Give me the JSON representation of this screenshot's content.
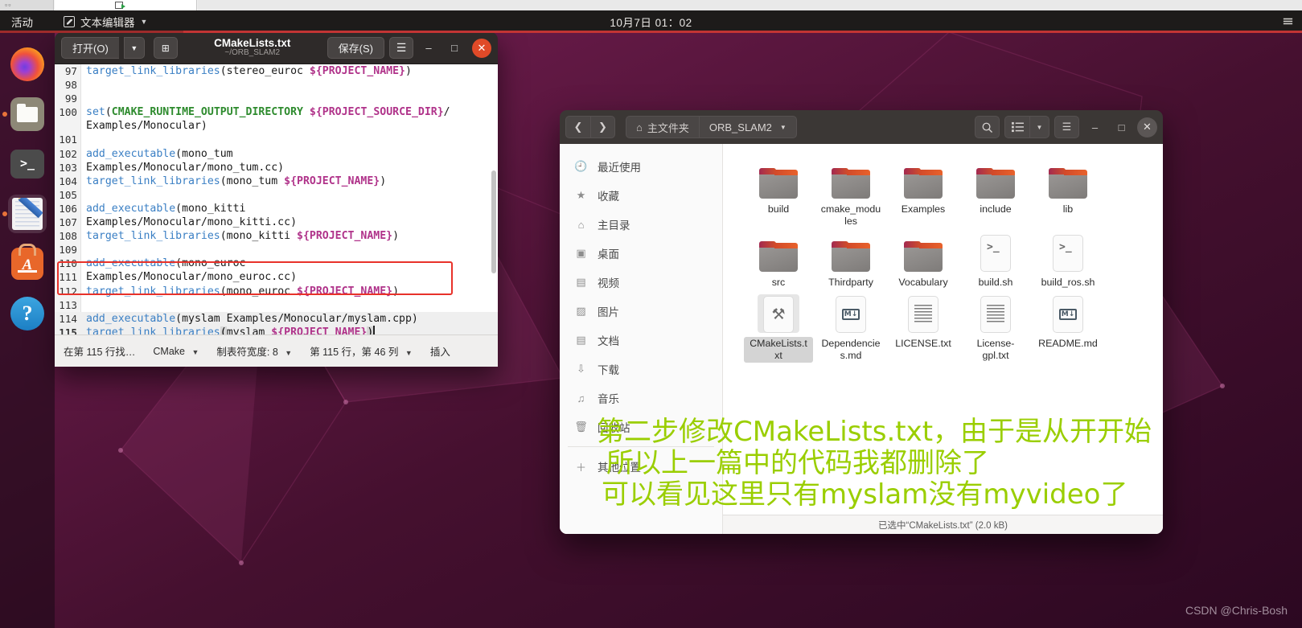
{
  "topbar": {
    "activities": "活动",
    "app_name": "文本编辑器",
    "app_icon": "text-editor-icon",
    "caret": "▼",
    "clock": "10月7日 01：02"
  },
  "dock": {
    "items": [
      {
        "name": "firefox",
        "label": "Firefox",
        "running": false
      },
      {
        "name": "files",
        "label": "文件",
        "running": true
      },
      {
        "name": "terminal",
        "label": "终端",
        "running": false
      },
      {
        "name": "text-editor",
        "label": "文本编辑器",
        "running": true
      },
      {
        "name": "ubuntu-software",
        "label": "Ubuntu 软件",
        "running": false
      },
      {
        "name": "help",
        "label": "帮助",
        "running": false
      }
    ]
  },
  "gedit": {
    "open_label": "打开(O)",
    "open_dropdown": "▼",
    "new_tab_icon": "new-tab-icon",
    "title": "CMakeLists.txt",
    "subtitle": "~/ORB_SLAM2",
    "save_label": "保存(S)",
    "menu_icon": "☰",
    "minimize": "–",
    "maximize": "□",
    "close": "✕",
    "lines": [
      {
        "n": "97",
        "parts": [
          {
            "t": "target_link_libraries",
            "c": "fn"
          },
          {
            "t": "(stereo_euroc ",
            "c": "pl"
          },
          {
            "t": "${PROJECT_NAME}",
            "c": "ref"
          },
          {
            "t": ")",
            "c": "pl"
          }
        ]
      },
      {
        "n": "98",
        "parts": []
      },
      {
        "n": "99",
        "parts": []
      },
      {
        "n": "100",
        "parts": [
          {
            "t": "set",
            "c": "fn"
          },
          {
            "t": "(",
            "c": "pl"
          },
          {
            "t": "CMAKE_RUNTIME_OUTPUT_DIRECTORY",
            "c": "var"
          },
          {
            "t": " ",
            "c": "pl"
          },
          {
            "t": "${PROJECT_SOURCE_DIR}",
            "c": "ref"
          },
          {
            "t": "/",
            "c": "pl"
          }
        ]
      },
      {
        "n": "",
        "parts": [
          {
            "t": "Examples/Monocular)",
            "c": "pl"
          }
        ]
      },
      {
        "n": "101",
        "parts": []
      },
      {
        "n": "102",
        "parts": [
          {
            "t": "add_executable",
            "c": "fn"
          },
          {
            "t": "(mono_tum",
            "c": "pl"
          }
        ]
      },
      {
        "n": "103",
        "parts": [
          {
            "t": "Examples/Monocular/mono_tum.cc)",
            "c": "pl"
          }
        ]
      },
      {
        "n": "104",
        "parts": [
          {
            "t": "target_link_libraries",
            "c": "fn"
          },
          {
            "t": "(mono_tum ",
            "c": "pl"
          },
          {
            "t": "${PROJECT_NAME}",
            "c": "ref"
          },
          {
            "t": ")",
            "c": "pl"
          }
        ]
      },
      {
        "n": "105",
        "parts": []
      },
      {
        "n": "106",
        "parts": [
          {
            "t": "add_executable",
            "c": "fn"
          },
          {
            "t": "(mono_kitti",
            "c": "pl"
          }
        ]
      },
      {
        "n": "107",
        "parts": [
          {
            "t": "Examples/Monocular/mono_kitti.cc)",
            "c": "pl"
          }
        ]
      },
      {
        "n": "108",
        "parts": [
          {
            "t": "target_link_libraries",
            "c": "fn"
          },
          {
            "t": "(mono_kitti ",
            "c": "pl"
          },
          {
            "t": "${PROJECT_NAME}",
            "c": "ref"
          },
          {
            "t": ")",
            "c": "pl"
          }
        ]
      },
      {
        "n": "109",
        "parts": []
      },
      {
        "n": "110",
        "parts": [
          {
            "t": "add_executable",
            "c": "fn"
          },
          {
            "t": "(mono_euroc",
            "c": "pl"
          }
        ]
      },
      {
        "n": "111",
        "parts": [
          {
            "t": "Examples/Monocular/mono_euroc.cc)",
            "c": "pl"
          }
        ]
      },
      {
        "n": "112",
        "parts": [
          {
            "t": "target_link_libraries",
            "c": "fn"
          },
          {
            "t": "(mono_euroc ",
            "c": "pl"
          },
          {
            "t": "${PROJECT_NAME}",
            "c": "ref"
          },
          {
            "t": ")",
            "c": "pl"
          }
        ]
      },
      {
        "n": "113",
        "parts": []
      },
      {
        "n": "114",
        "parts": [
          {
            "t": "add_executable",
            "c": "fn"
          },
          {
            "t": "(myslam Examples/Monocular/myslam.cpp)",
            "c": "pl"
          }
        ]
      },
      {
        "n": "115",
        "parts": [
          {
            "t": "target_link_libraries",
            "c": "fn"
          },
          {
            "t": "(",
            "c": "paren-hl"
          },
          {
            "t": "myslam ",
            "c": "pl"
          },
          {
            "t": "${PROJECT_NAME}",
            "c": "ref"
          },
          {
            "t": ")",
            "c": "paren-hl"
          }
        ]
      }
    ],
    "status": {
      "find": "在第 115 行找…",
      "language": "CMake",
      "language_caret": "▼",
      "tab_width": "制表符宽度: 8",
      "tab_caret": "▼",
      "position": "第 115 行，第 46 列",
      "position_caret": "▼",
      "mode": "插入"
    }
  },
  "nautilus": {
    "back_icon": "❮",
    "forward_icon": "❯",
    "home_icon": "⌂",
    "crumb_home": "主文件夹",
    "crumb_current": "ORB_SLAM2",
    "crumb_caret": "▼",
    "search_icon": "search-icon",
    "list_view_icon": "list-view-icon",
    "view_caret": "▼",
    "menu_icon": "☰",
    "minimize": "–",
    "maximize": "□",
    "close": "✕",
    "sidebar": [
      {
        "label": "最近使用",
        "icon": "clock-icon"
      },
      {
        "label": "收藏",
        "icon": "star-icon"
      },
      {
        "label": "主目录",
        "icon": "home-icon"
      },
      {
        "label": "桌面",
        "icon": "desktop-icon"
      },
      {
        "label": "视频",
        "icon": "video-icon"
      },
      {
        "label": "图片",
        "icon": "picture-icon"
      },
      {
        "label": "文档",
        "icon": "document-icon"
      },
      {
        "label": "下载",
        "icon": "download-icon"
      },
      {
        "label": "音乐",
        "icon": "music-icon"
      },
      {
        "label": "回收站",
        "icon": "trash-icon"
      }
    ],
    "sidebar_bottom": [
      {
        "label": "其他位置",
        "icon": "plus-icon"
      }
    ],
    "files": [
      {
        "name": "build",
        "type": "folder",
        "selected": false
      },
      {
        "name": "cmake_modules",
        "type": "folder",
        "selected": false
      },
      {
        "name": "Examples",
        "type": "folder",
        "selected": false
      },
      {
        "name": "include",
        "type": "folder",
        "selected": false
      },
      {
        "name": "lib",
        "type": "folder",
        "selected": false
      },
      {
        "name": "src",
        "type": "folder",
        "selected": false
      },
      {
        "name": "Thirdparty",
        "type": "folder",
        "selected": false
      },
      {
        "name": "Vocabulary",
        "type": "folder",
        "selected": false
      },
      {
        "name": "build.sh",
        "type": "shell",
        "selected": false
      },
      {
        "name": "build_ros.sh",
        "type": "shell",
        "selected": false
      },
      {
        "name": "CMakeLists.txt",
        "type": "cmake",
        "selected": true
      },
      {
        "name": "Dependencies.md",
        "type": "markdown",
        "selected": false
      },
      {
        "name": "LICENSE.txt",
        "type": "text",
        "selected": false
      },
      {
        "name": "License-gpl.txt",
        "type": "text",
        "selected": false
      },
      {
        "name": "README.md",
        "type": "markdown",
        "selected": false
      }
    ],
    "status": "已选中“CMakeLists.txt” (2.0 kB)"
  },
  "annotation": {
    "line1": "第二步修改CMakeLists.txt，由于是从开开始",
    "line2": "所以上一篇中的代码我都删除了",
    "line3": "可以看见这里只有myslam没有myvideo了",
    "color": "#9ace00"
  },
  "watermark": "CSDN @Chris-Bosh"
}
